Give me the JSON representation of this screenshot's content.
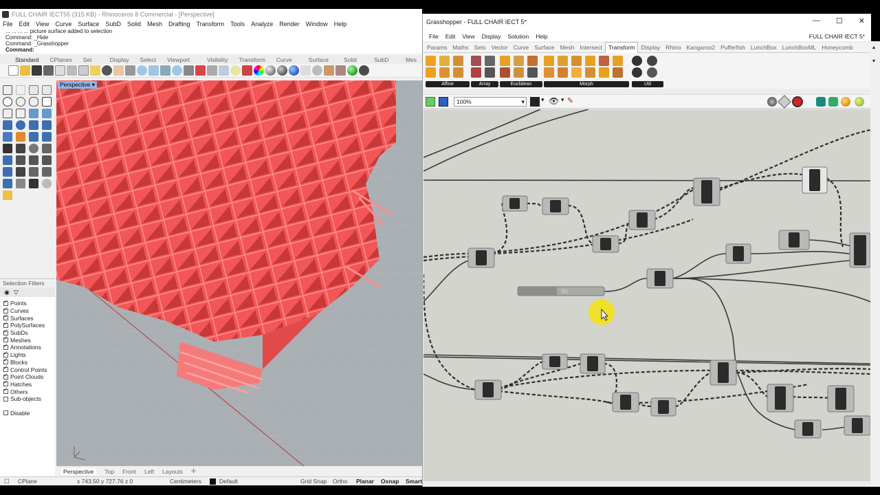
{
  "rhino": {
    "title": "FULL CHAIR IECT55 (315 KB) - Rhinoceros 8 Commercial - [Perspective]",
    "menu": [
      "File",
      "Edit",
      "View",
      "Curve",
      "Surface",
      "SubD",
      "Solid",
      "Mesh",
      "Drafting",
      "Transform",
      "Tools",
      "Analyze",
      "Render",
      "Window",
      "Help"
    ],
    "command_lines": [
      "... ... ... ... picture surface added to selection",
      "Command: _Hide",
      "Command: _Grasshopper",
      "Command:"
    ],
    "toolbar_tabs": [
      "Standard",
      "CPlanes",
      "Set View",
      "Display",
      "Select",
      "Viewport Layout",
      "Visibility",
      "Transform",
      "Curve Tools",
      "Surface Tools",
      "Solid Tools",
      "SubD Tools",
      "Mes"
    ],
    "viewport_label": "Perspective",
    "viewport_tabs": [
      "Perspective",
      "Top",
      "Front",
      "Left",
      "Layouts"
    ],
    "selection_filters": {
      "header": "Selection Filters",
      "items": [
        {
          "label": "Points",
          "checked": true
        },
        {
          "label": "Curves",
          "checked": true
        },
        {
          "label": "Surfaces",
          "checked": true
        },
        {
          "label": "PolySurfaces",
          "checked": true
        },
        {
          "label": "SubDs",
          "checked": true
        },
        {
          "label": "Meshes",
          "checked": true
        },
        {
          "label": "Annotations",
          "checked": true
        },
        {
          "label": "Lights",
          "checked": true
        },
        {
          "label": "Blocks",
          "checked": true
        },
        {
          "label": "Control Points",
          "checked": true
        },
        {
          "label": "Point Clouds",
          "checked": true
        },
        {
          "label": "Hatches",
          "checked": true
        },
        {
          "label": "Others",
          "checked": true
        },
        {
          "label": "Sub-objects",
          "checked": false
        }
      ],
      "disable": "Disable"
    },
    "status": {
      "cplane": "CPlane",
      "coords": "x 743.50  y 727.76  z 0",
      "units": "Centimeters",
      "layer": "Default",
      "grid_snap": "Grid Snap",
      "ortho": "Ortho",
      "planar": "Planar",
      "osnap": "Osnap",
      "smart": "Smart"
    },
    "colors": {
      "model": "#f25050",
      "viewport_bg": "#a9afb3",
      "viewport_label_bg": "#8fb6e8"
    }
  },
  "gh": {
    "title": "Grasshopper - FULL CHAIR  IECT 5*",
    "window_controls": [
      "—",
      "☐",
      "✕"
    ],
    "menu": [
      "File",
      "Edit",
      "View",
      "Display",
      "Solution",
      "Help"
    ],
    "document_name": "FULL CHAIR  IECT 5*",
    "tabs": [
      "Params",
      "Maths",
      "Sets",
      "Vector",
      "Curve",
      "Surface",
      "Mesh",
      "Intersect",
      "Transform",
      "Display",
      "Rhino",
      "Kangaroo2",
      "Pufferfish",
      "LunchBox",
      "LunchBoxML",
      "Honeycomb"
    ],
    "active_tab": "Transform",
    "ribbon_groups": [
      "Affine",
      "Array",
      "Euclidean",
      "Morph",
      "Util"
    ],
    "zoom": "100%",
    "canvas_bg": "#d3d4cd"
  }
}
